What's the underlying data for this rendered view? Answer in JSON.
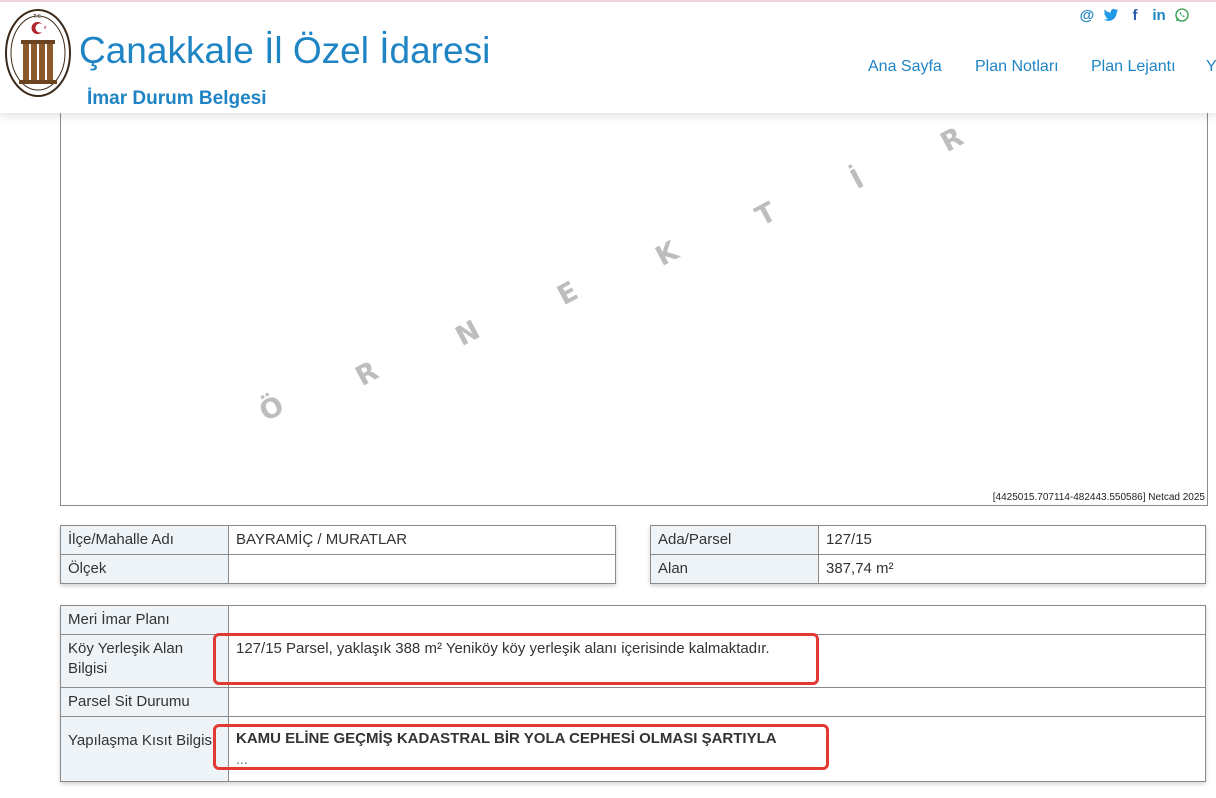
{
  "header": {
    "title": "Çanakkale İl Özel İdaresi",
    "subtitle": "İmar Durum Belgesi",
    "logo_text": "T.C. ÇANAKKALE İL ÖZEL İDARESİ"
  },
  "social": {
    "email": "@",
    "twitter": "twitter-icon",
    "facebook": "f",
    "linkedin": "in",
    "whatsapp": "whatsapp-icon"
  },
  "nav": {
    "items": [
      {
        "label": "Ana Sayfa"
      },
      {
        "label": "Plan Notları"
      },
      {
        "label": "Plan Lejantı"
      },
      {
        "label": "Y"
      }
    ]
  },
  "map": {
    "watermark": [
      "Ö",
      "R",
      "N",
      "E",
      "K",
      "T",
      "İ",
      "R"
    ],
    "coords": "[4425015.707114-482443.550586] Netcad 2025"
  },
  "table_left": {
    "rows": [
      {
        "label": "İlçe/Mahalle Adı",
        "value": "BAYRAMİÇ / MURATLAR"
      },
      {
        "label": "Ölçek",
        "value": ""
      }
    ]
  },
  "table_right": {
    "rows": [
      {
        "label": "Ada/Parsel",
        "value": "127/15"
      },
      {
        "label": "Alan",
        "value": "387,74 m²"
      }
    ]
  },
  "table_main": {
    "rows": [
      {
        "label": "Meri İmar Planı",
        "value": ""
      },
      {
        "label": "Köy Yerleşik Alan Bilgisi",
        "value": "127/15 Parsel, yaklaşık 388 m² Yeniköy köy yerleşik alanı içerisinde kalmaktadır."
      },
      {
        "label": "Parsel Sit Durumu",
        "value": ""
      },
      {
        "label": "Yapılaşma Kısıt Bilgisi",
        "value": "KAMU ELİNE GEÇMİŞ KADASTRAL BİR YOLA CEPHESİ OLMASI ŞARTIYLA",
        "extra": "..."
      }
    ]
  },
  "colors": {
    "brand_blue": "#1f84c4",
    "highlight_red": "#e03a33",
    "label_bg": "#eef3f7"
  }
}
